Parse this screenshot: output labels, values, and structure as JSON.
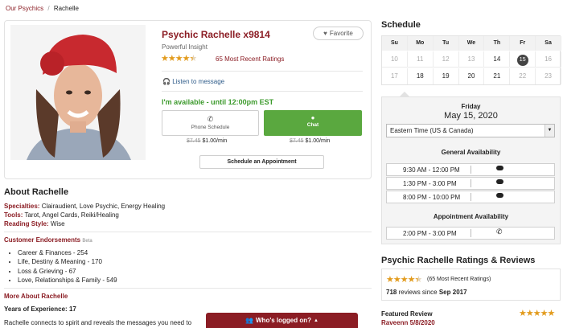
{
  "breadcrumb": {
    "link": "Our Psychics",
    "separator": "/",
    "current": "Rachelle"
  },
  "profile": {
    "name": "Psychic Rachelle x9814",
    "subtitle": "Powerful Insight",
    "rating_stars": 4.5,
    "ratings_link": "65 Most Recent Ratings",
    "favorite_label": "Favorite",
    "listen_label": "Listen to message",
    "availability": "I'm available - until 12:00pm EST",
    "phone_label": "Phone Schedule",
    "chat_label": "Chat",
    "phone_old_price": "$7.45",
    "phone_price": "$1.00/min",
    "chat_old_price": "$7.45",
    "chat_price": "$1.00/min",
    "schedule_button": "Schedule an Appointment"
  },
  "about": {
    "heading": "About Rachelle",
    "specialties_label": "Specialties:",
    "specialties": "Clairaudient, Love Psychic, Energy Healing",
    "tools_label": "Tools:",
    "tools": "Tarot, Angel Cards, Reiki/Healing",
    "style_label": "Reading Style:",
    "style": "Wise"
  },
  "endorsements": {
    "heading": "Customer Endorsements",
    "badge": "Beta",
    "items": [
      "Career & Finances - 254",
      "Life, Destiny & Meaning - 170",
      "Loss & Grieving - 67",
      "Love, Relationships & Family - 549"
    ]
  },
  "more_about": {
    "heading": "More About Rachelle",
    "experience_label": "Years of Experience:",
    "experience": "17",
    "bio": "Rachelle connects to spirit and reveals the messages you need to"
  },
  "whos_logged_on": "Who's logged on?",
  "schedule": {
    "heading": "Schedule",
    "weekdays": [
      "Su",
      "Mo",
      "Tu",
      "We",
      "Th",
      "Fr",
      "Sa"
    ],
    "week1": [
      "10",
      "11",
      "12",
      "13",
      "14",
      "15",
      "16"
    ],
    "week2": [
      "17",
      "18",
      "19",
      "20",
      "21",
      "22",
      "23"
    ],
    "selected_day": "15",
    "day_name": "Friday",
    "date": "May 15, 2020",
    "timezone": "Eastern Time (US & Canada)",
    "general_heading": "General Availability",
    "general_slots": [
      "9:30 AM - 12:00 PM",
      "1:30 PM - 3:00 PM",
      "8:00 PM - 10:00 PM"
    ],
    "appointment_heading": "Appointment Availability",
    "appointment_slots": [
      "2:00 PM - 3:00 PM"
    ]
  },
  "ratings_section": {
    "heading": "Psychic Rachelle Ratings & Reviews",
    "count_text": "(65 Most Recent Ratings)",
    "reviews_count": "718",
    "reviews_text": "reviews since",
    "since": "Sep 2017",
    "featured_label": "Featured Review",
    "featured_author": "Raveenn",
    "featured_date": "5/8/2020"
  },
  "colors": {
    "brand": "#8b1d24",
    "available": "#3c9a2c",
    "chat_button": "#5aa83f",
    "stars": "#e29b1d"
  }
}
